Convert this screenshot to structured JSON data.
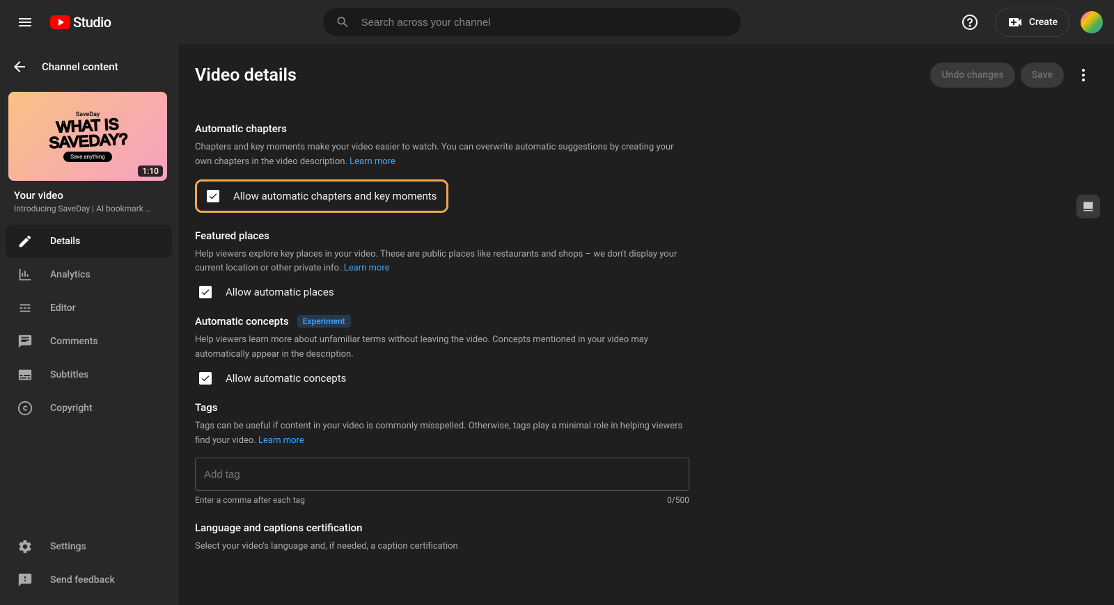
{
  "header": {
    "logo_text": "Studio",
    "search_placeholder": "Search across your channel",
    "create_label": "Create"
  },
  "sidebar": {
    "back_label": "Channel content",
    "thumb_toptext": "SaveDay",
    "thumb_bigtext1": "WHAT IS",
    "thumb_bigtext2": "SAVEDAY?",
    "thumb_pill": "Save anything",
    "thumb_duration": "1:10",
    "meta_title": "Your video",
    "meta_subtitle": "Introducing SaveDay | AI bookmark …",
    "nav": [
      {
        "icon": "pencil",
        "label": "Details",
        "active": true
      },
      {
        "icon": "analytics",
        "label": "Analytics",
        "active": false
      },
      {
        "icon": "editor",
        "label": "Editor",
        "active": false
      },
      {
        "icon": "comments",
        "label": "Comments",
        "active": false
      },
      {
        "icon": "subtitles",
        "label": "Subtitles",
        "active": false
      },
      {
        "icon": "copyright",
        "label": "Copyright",
        "active": false
      }
    ],
    "bottom": [
      {
        "icon": "gear",
        "label": "Settings"
      },
      {
        "icon": "feedback",
        "label": "Send feedback"
      }
    ]
  },
  "main": {
    "title": "Video details",
    "undo_label": "Undo changes",
    "save_label": "Save",
    "sections": {
      "auto_chapters": {
        "title": "Automatic chapters",
        "desc": "Chapters and key moments make your video easier to watch. You can overwrite automatic suggestions by creating your own chapters in the video description.",
        "learn": "Learn more",
        "checkbox_label": "Allow automatic chapters and key moments",
        "checked": true
      },
      "featured_places": {
        "title": "Featured places",
        "desc": "Help viewers explore key places in your video. These are public places like restaurants and shops – we don't display your current location or other private info.",
        "learn": "Learn more",
        "checkbox_label": "Allow automatic places",
        "checked": true
      },
      "auto_concepts": {
        "title": "Automatic concepts",
        "badge": "Experiment",
        "desc": "Help viewers learn more about unfamiliar terms without leaving the video. Concepts mentioned in your video may automatically appear in the description.",
        "checkbox_label": "Allow automatic concepts",
        "checked": true
      },
      "tags": {
        "title": "Tags",
        "desc": "Tags can be useful if content in your video is commonly misspelled. Otherwise, tags play a minimal role in helping viewers find your video.",
        "learn": "Learn more",
        "placeholder": "Add tag",
        "hint": "Enter a comma after each tag",
        "counter": "0/500"
      },
      "language": {
        "title": "Language and captions certification",
        "desc": "Select your video's language and, if needed, a caption certification"
      }
    }
  }
}
